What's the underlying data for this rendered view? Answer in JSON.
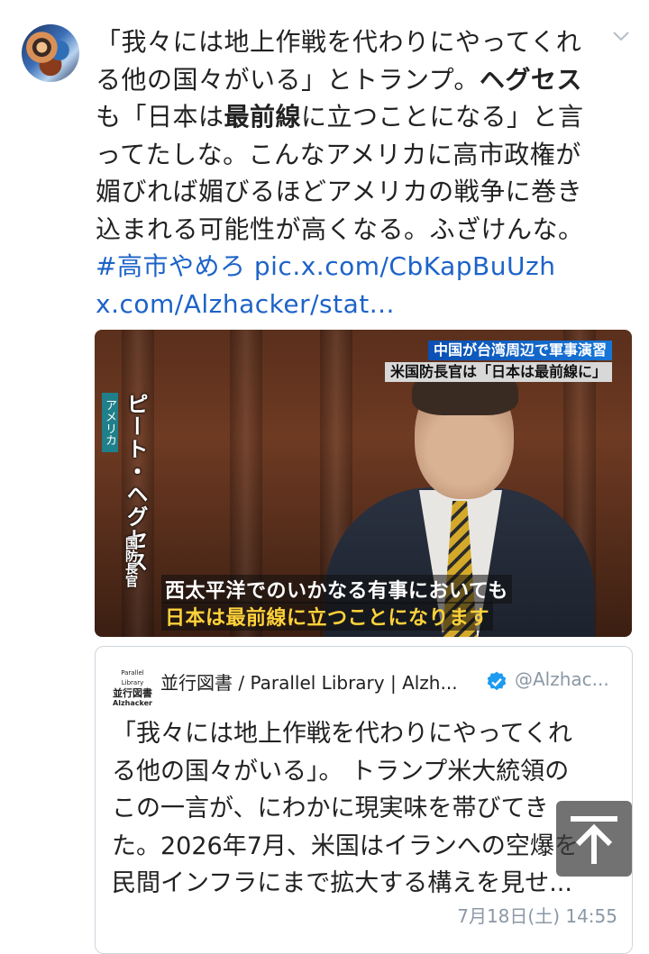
{
  "tweet": {
    "line1": "「我々には地上作戦を代わりにやってくれ",
    "line2_a": "る他の国々がいる」とトランプ。",
    "line2_b": "ヘグセス",
    "line3_a": "も「日本は",
    "line3_b": "最前線",
    "line3_c": "に立つことになる」と言",
    "line4": "ってたしな。こんなアメリカに高市政権が",
    "line5": "媚びれば媚びるほどアメリカの戦争に巻き",
    "line6": "込まれる可能性が高くなる。ふざけんな。",
    "hashtag": "#高市やめろ",
    "pic_link": "pic.x.com/CbKapBuUzh",
    "url_link": "x.com/Alzhacker/stat..."
  },
  "media": {
    "headline1": "中国が台湾周辺で軍事演習",
    "headline2": "米国防長官は「日本は最前線に」",
    "tag": "アメリカ",
    "name": "ピート・ヘグセス",
    "role": "国防長官",
    "subtitle1": "西太平洋でのいかなる有事においても",
    "subtitle2": "日本は最前線に立つことになります"
  },
  "quote": {
    "logo_top": "Parallel Library",
    "logo_mid": "並行図書",
    "logo_bottom": "Alzhacker",
    "name": "並行図書 / Parallel Library | Alzh...",
    "handle": "@Alzhac...",
    "lines": [
      "「我々には地上作戦を代わりにやってくれ",
      "る他の国々がいる」。 トランプ米大統領の",
      "この一言が、にわかに現実味を帯びてき",
      "た。2026年7月、米国はイランへの空爆を",
      "民間インフラにまで拡大する構えを見せ..."
    ],
    "timestamp": "7月18日(土) 14:55"
  },
  "icons": {
    "chevron": "chevron-down-icon",
    "verified": "verified-badge-icon",
    "scroll_top": "arrow-up-to-top-icon"
  },
  "colors": {
    "link": "#1d63c8",
    "verified": "#1d9bf0",
    "muted": "#8b98a5"
  }
}
